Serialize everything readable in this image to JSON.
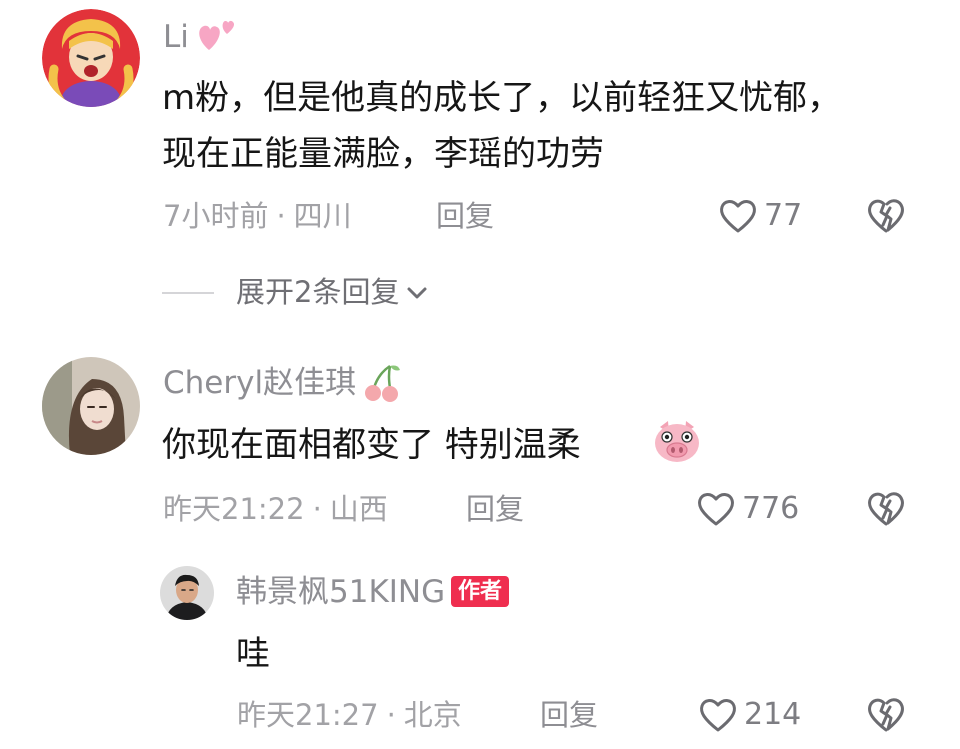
{
  "comments": [
    {
      "username": "Li",
      "text_lines": [
        "m粉，但是他真的成长了，以前轻狂又忧郁，",
        "现在正能量满脸，李瑶的功劳"
      ],
      "time": "7小时前",
      "location": "四川",
      "reply_label": "回复",
      "likes": "77",
      "expand_label": "展开2条回复",
      "name_emoji": "two-hearts-icon"
    },
    {
      "username": "Cheryl赵佳琪",
      "text_lines": [
        "你现在面相都变了 特别温柔"
      ],
      "time": "昨天21:22",
      "location": "山西",
      "reply_label": "回复",
      "likes": "776",
      "name_emoji": "cherries-icon",
      "text_emoji": "pig-face-icon"
    }
  ],
  "reply": {
    "username": "韩景枫51KING",
    "author_badge": "作者",
    "text": "哇",
    "time": "昨天21:27",
    "location": "北京",
    "reply_label": "回复",
    "likes": "214"
  },
  "separator": "·",
  "colors": {
    "text": "#161616",
    "meta": "#a2a2a6",
    "badge": "#ef2e4f",
    "pink": "#f7a6c4"
  }
}
